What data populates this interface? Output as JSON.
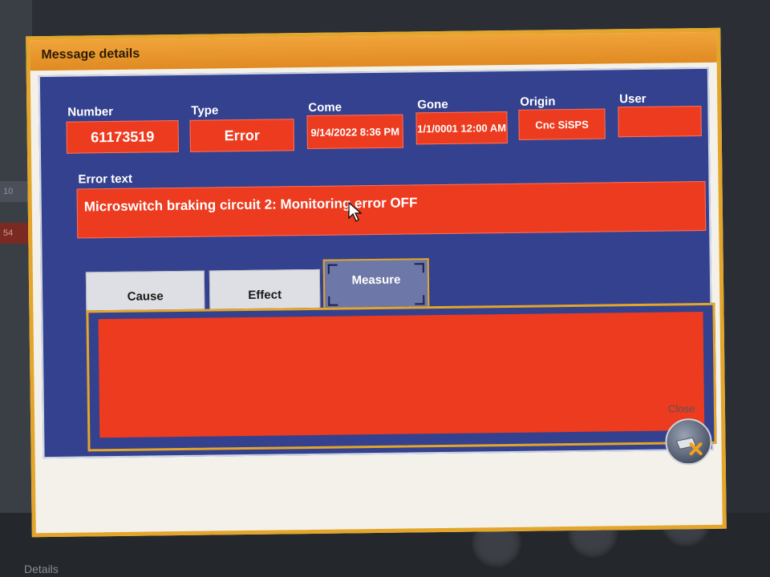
{
  "dialog": {
    "title": "Message details"
  },
  "fields": {
    "number": {
      "label": "Number",
      "value": "61173519"
    },
    "type": {
      "label": "Type",
      "value": "Error"
    },
    "come": {
      "label": "Come",
      "value": "9/14/2022 8:36 PM"
    },
    "gone": {
      "label": "Gone",
      "value": "1/1/0001 12:00 AM"
    },
    "origin": {
      "label": "Origin",
      "value": "Cnc SiSPS"
    },
    "user": {
      "label": "User",
      "value": ""
    }
  },
  "error_text": {
    "label": "Error text",
    "value": "Microswitch braking circuit 2: Monitoring error OFF"
  },
  "tabs": [
    {
      "label": "Cause"
    },
    {
      "label": "Effect"
    },
    {
      "label": "Measure",
      "active": true
    }
  ],
  "measure_content": "",
  "close": {
    "label": "Close"
  },
  "background": {
    "side_values": [
      "10",
      "54"
    ],
    "details_label": "Details"
  },
  "colors": {
    "frame": "#e3a52a",
    "panel": "#34418e",
    "field": "#ec3b1f",
    "active_tab": "#6d77a8"
  },
  "icons": {
    "close": "close-x-icon",
    "cursor": "mouse-pointer-icon"
  }
}
